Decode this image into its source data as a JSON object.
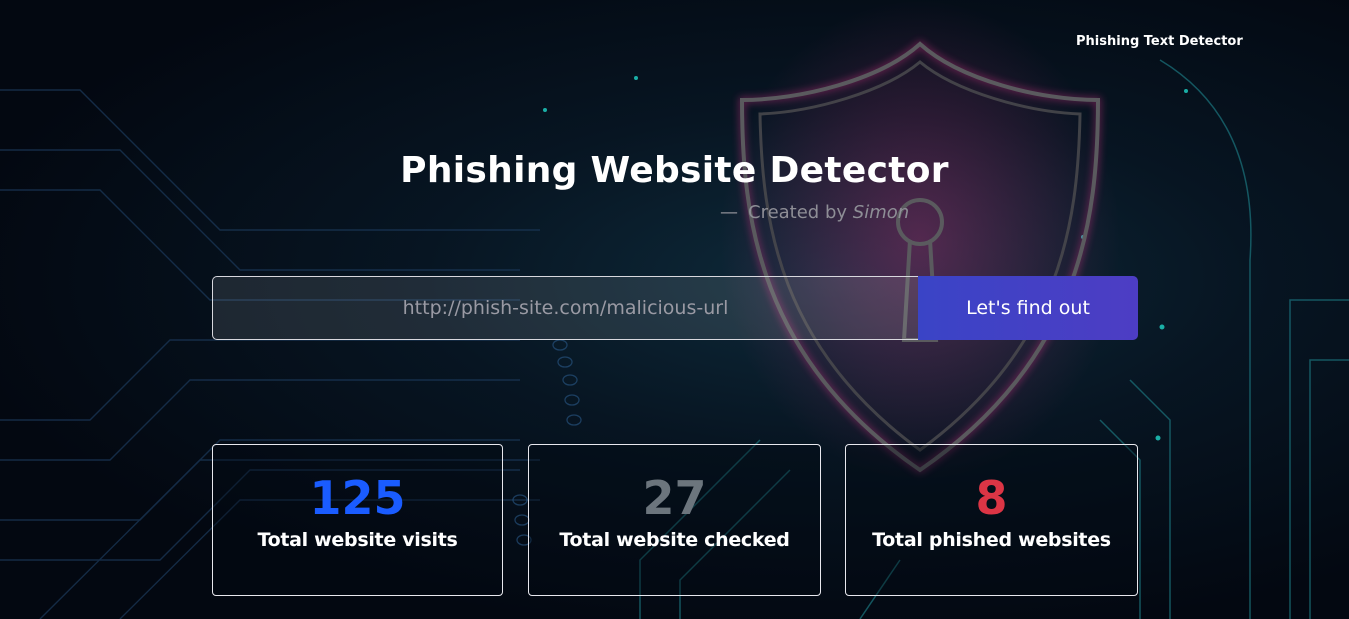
{
  "header": {
    "nav_link": "Phishing Text Detector"
  },
  "hero": {
    "title": "Phishing Website Detector",
    "byline_dash": "—",
    "byline_prefix": "Created by",
    "byline_author": "Simon"
  },
  "search": {
    "placeholder": "http://phish-site.com/malicious-url",
    "value": "",
    "button_label": "Let's find out"
  },
  "stats": [
    {
      "value": "125",
      "label": "Total website visits",
      "color": "#1a5cff"
    },
    {
      "value": "27",
      "label": "Total website checked",
      "color": "#6c757d"
    },
    {
      "value": "8",
      "label": "Total phished websites",
      "color": "#dc3545"
    }
  ],
  "background": {
    "icon": "shield-lock-icon",
    "glow_pink": "#d63384",
    "circuit_color": "#1fd6c8"
  }
}
